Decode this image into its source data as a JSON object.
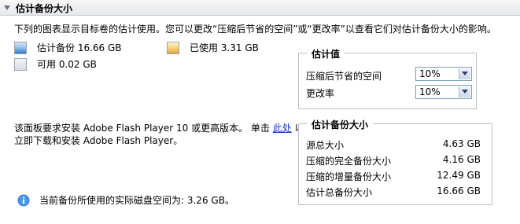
{
  "header": {
    "title": "估计备份大小"
  },
  "description": "下列的图表显示目标卷的估计使用。您可以更改“压缩后节省的空间”或“更改率”以查看它们对估计备份大小的影响。",
  "legend": {
    "estimated": "估计备份 16.66 GB",
    "used": "已使用 3.31 GB",
    "free": "可用 0.02 GB"
  },
  "flash_notice": {
    "part1": "该面板要求安装 Adobe Flash Player 10 或更高版本。  单击 ",
    "link": "此处",
    "part2": " 以",
    "line2": "立即下载和安装 Adobe Flash Player。"
  },
  "info": {
    "text": "当前备份所使用的实际磁盘空间为: 3.26 GB。"
  },
  "estimates_panel": {
    "title": "估计值",
    "compression_label": "压缩后节省的空间",
    "compression_value": "10%",
    "change_rate_label": "更改率",
    "change_rate_value": "10%"
  },
  "size_panel": {
    "title": "估计备份大小",
    "rows": [
      {
        "label": "源总大小",
        "value": "4.63 GB"
      },
      {
        "label": "压缩的完全备份大小",
        "value": "4.16 GB"
      },
      {
        "label": "压缩的增量备份大小",
        "value": "12.49 GB"
      },
      {
        "label": "估计总备份大小",
        "value": "16.66 GB"
      }
    ]
  },
  "icons": {
    "collapse": "triangle-down-icon",
    "info": "info-icon",
    "dropdown": "chevron-down-icon"
  },
  "colors": {
    "link": "#1a35c9",
    "estimated_swatch": "#5b9ee0",
    "used_swatch": "#f2c46a",
    "free_swatch": "#dfe4ea",
    "panel_border": "#b9c1cc"
  }
}
